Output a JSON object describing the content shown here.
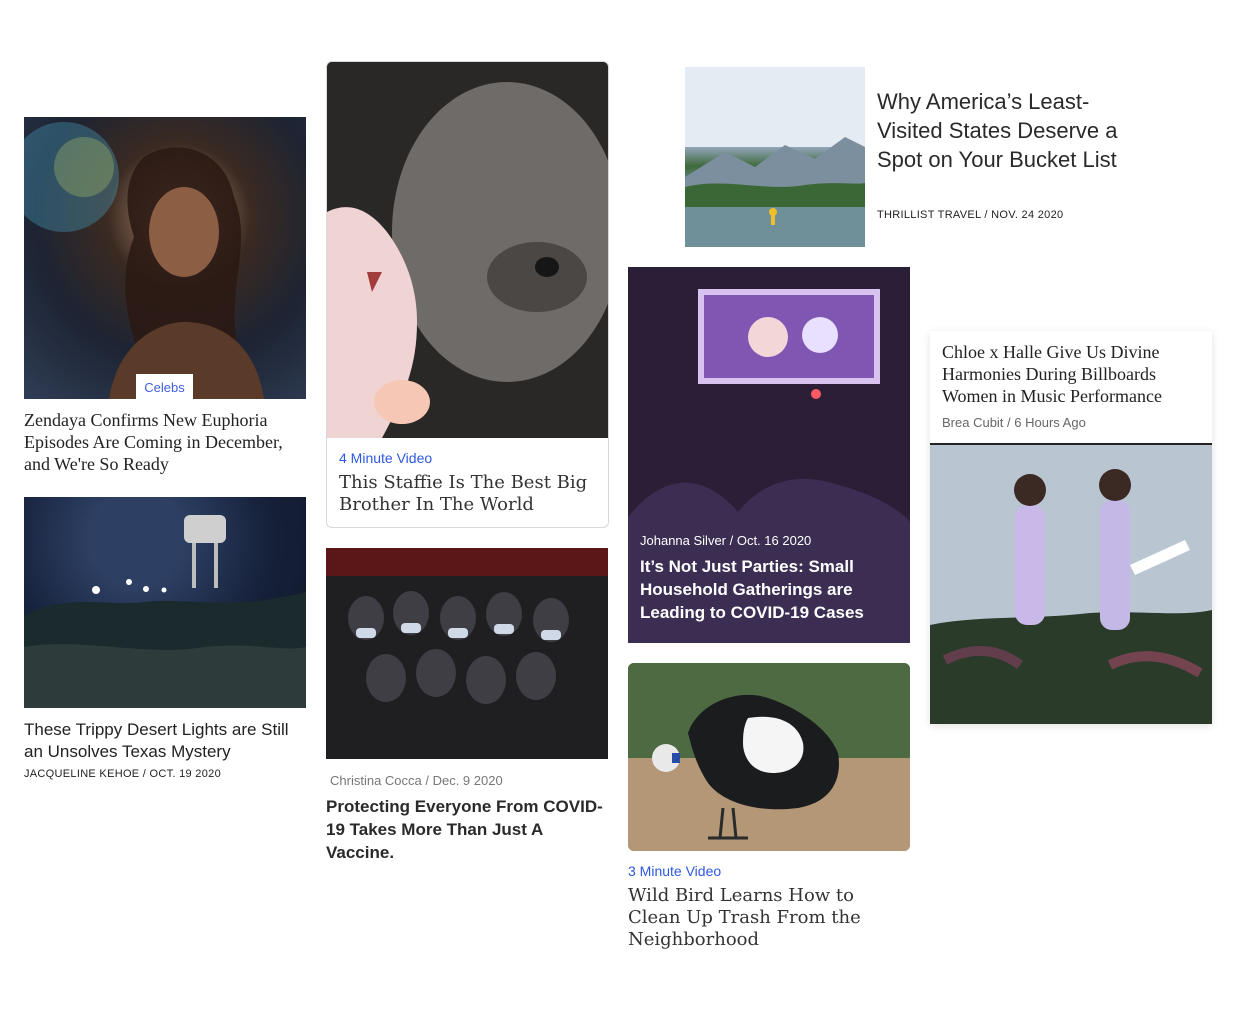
{
  "cards": [
    {
      "tag": "Celebs",
      "title": "Zendaya Confirms New Euphoria Episodes Are Coming in December, and We're So Ready",
      "image": "image-zendaya"
    },
    {
      "title": "These Trippy Desert Lights are Still an Unsolves Texas Mystery",
      "meta": "JACQUELINE KEHOE / OCT. 19 2020",
      "image": "image-desert-lights"
    },
    {
      "kicker": "4 Minute Video",
      "title": "This Staffie Is The Best Big Brother In The World",
      "image": "image-staffie-dog"
    },
    {
      "meta": "Christina Cocca / Dec. 9 2020",
      "title": "Protecting Everyone From COVID-19 Takes More Than Just A Vaccine.",
      "image": "image-masked-crowd"
    },
    {
      "title": "Why America’s Least-Visited States Deserve a Spot on Your Bucket List",
      "meta": "THRILLIST TRAVEL / NOV. 24 2020",
      "image": "image-lake-paddler"
    },
    {
      "meta": "Johanna Silver / Oct. 16 2020",
      "title": "It’s Not Just Parties: Small Household Gatherings are Leading to COVID-19 Cases",
      "image": "image-family-tv"
    },
    {
      "kicker": "3 Minute Video",
      "title": "Wild Bird Learns How to Clean Up Trash From the Neighborhood",
      "image": "image-magpie"
    },
    {
      "title": "Chloe x Halle Give Us Divine Harmonies During Billboards Women in Music Performance",
      "meta": "Brea Cubit / 6 Hours Ago",
      "image": "image-chloe-halle"
    }
  ],
  "colors": {
    "accent": "#2d58e0",
    "text": "#222222",
    "muted": "#777777"
  }
}
